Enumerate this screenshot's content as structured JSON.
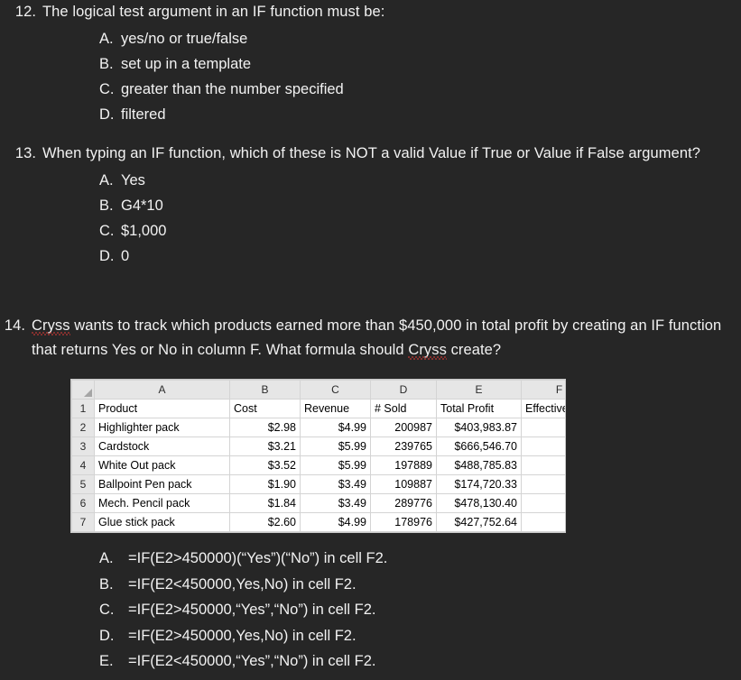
{
  "theme": {
    "background": "#262626",
    "text": "#f2f2f2",
    "spellcheck_underline": "#e23b36",
    "sheet_accent_green": "#1f7a43"
  },
  "questions": [
    {
      "number": "12.",
      "stem": "The logical test argument in an IF function must be:",
      "options": [
        {
          "letter": "A.",
          "text": "yes/no or true/false"
        },
        {
          "letter": "B.",
          "text": "set up in a template"
        },
        {
          "letter": "C.",
          "text": "greater than the number specified"
        },
        {
          "letter": "D.",
          "text": "filtered"
        }
      ]
    },
    {
      "number": "13.",
      "stem": "When typing an IF function, which of these is NOT a valid Value if True or Value if False argument?",
      "options": [
        {
          "letter": "A.",
          "text": "Yes"
        },
        {
          "letter": "B.",
          "text": "G4*10"
        },
        {
          "letter": "C.",
          "text": "$1,000"
        },
        {
          "letter": "D.",
          "text": "0"
        }
      ]
    },
    {
      "number": "14.",
      "stem_part1": "Cryss",
      "stem_part2": " wants to track which products earned more than $450,000 in total profit by creating an IF function that returns Yes or No in column F. What formula should ",
      "stem_part3": "Cryss",
      "stem_part4": " create?",
      "options": [
        {
          "letter": "A.",
          "text": "=IF(E2>450000)(“Yes”)(“No”) in cell F2."
        },
        {
          "letter": "B.",
          "text": "=IF(E2<450000,Yes,No) in cell F2."
        },
        {
          "letter": "C.",
          "text": "=IF(E2>450000,“Yes”,“No”) in cell F2."
        },
        {
          "letter": "D.",
          "text": "=IF(E2>450000,Yes,No) in cell F2."
        },
        {
          "letter": "E.",
          "text": "=IF(E2<450000,“Yes”,“No”) in cell F2."
        }
      ]
    }
  ],
  "spreadsheet": {
    "column_letters": [
      "A",
      "B",
      "C",
      "D",
      "E",
      "F"
    ],
    "row_numbers": [
      "1",
      "2",
      "3",
      "4",
      "5",
      "6",
      "7"
    ],
    "header_row": {
      "number": "1",
      "cells": [
        "Product",
        "Cost",
        "Revenue",
        "# Sold",
        "Total Profit",
        "Effective?"
      ]
    },
    "rows": [
      {
        "number": "2",
        "product": "Highlighter pack",
        "cost": "$2.98",
        "revenue": "$4.99",
        "sold": "200987",
        "profit": "$403,983.87",
        "effective": ""
      },
      {
        "number": "3",
        "product": "Cardstock",
        "cost": "$3.21",
        "revenue": "$5.99",
        "sold": "239765",
        "profit": "$666,546.70",
        "effective": ""
      },
      {
        "number": "4",
        "product": "White Out pack",
        "cost": "$3.52",
        "revenue": "$5.99",
        "sold": "197889",
        "profit": "$488,785.83",
        "effective": ""
      },
      {
        "number": "5",
        "product": "Ballpoint Pen pack",
        "cost": "$1.90",
        "revenue": "$3.49",
        "sold": "109887",
        "profit": "$174,720.33",
        "effective": ""
      },
      {
        "number": "6",
        "product": "Mech. Pencil pack",
        "cost": "$1.84",
        "revenue": "$3.49",
        "sold": "289776",
        "profit": "$478,130.40",
        "effective": ""
      },
      {
        "number": "7",
        "product": "Glue stick pack",
        "cost": "$2.60",
        "revenue": "$4.99",
        "sold": "178976",
        "profit": "$427,752.64",
        "effective": ""
      }
    ]
  }
}
